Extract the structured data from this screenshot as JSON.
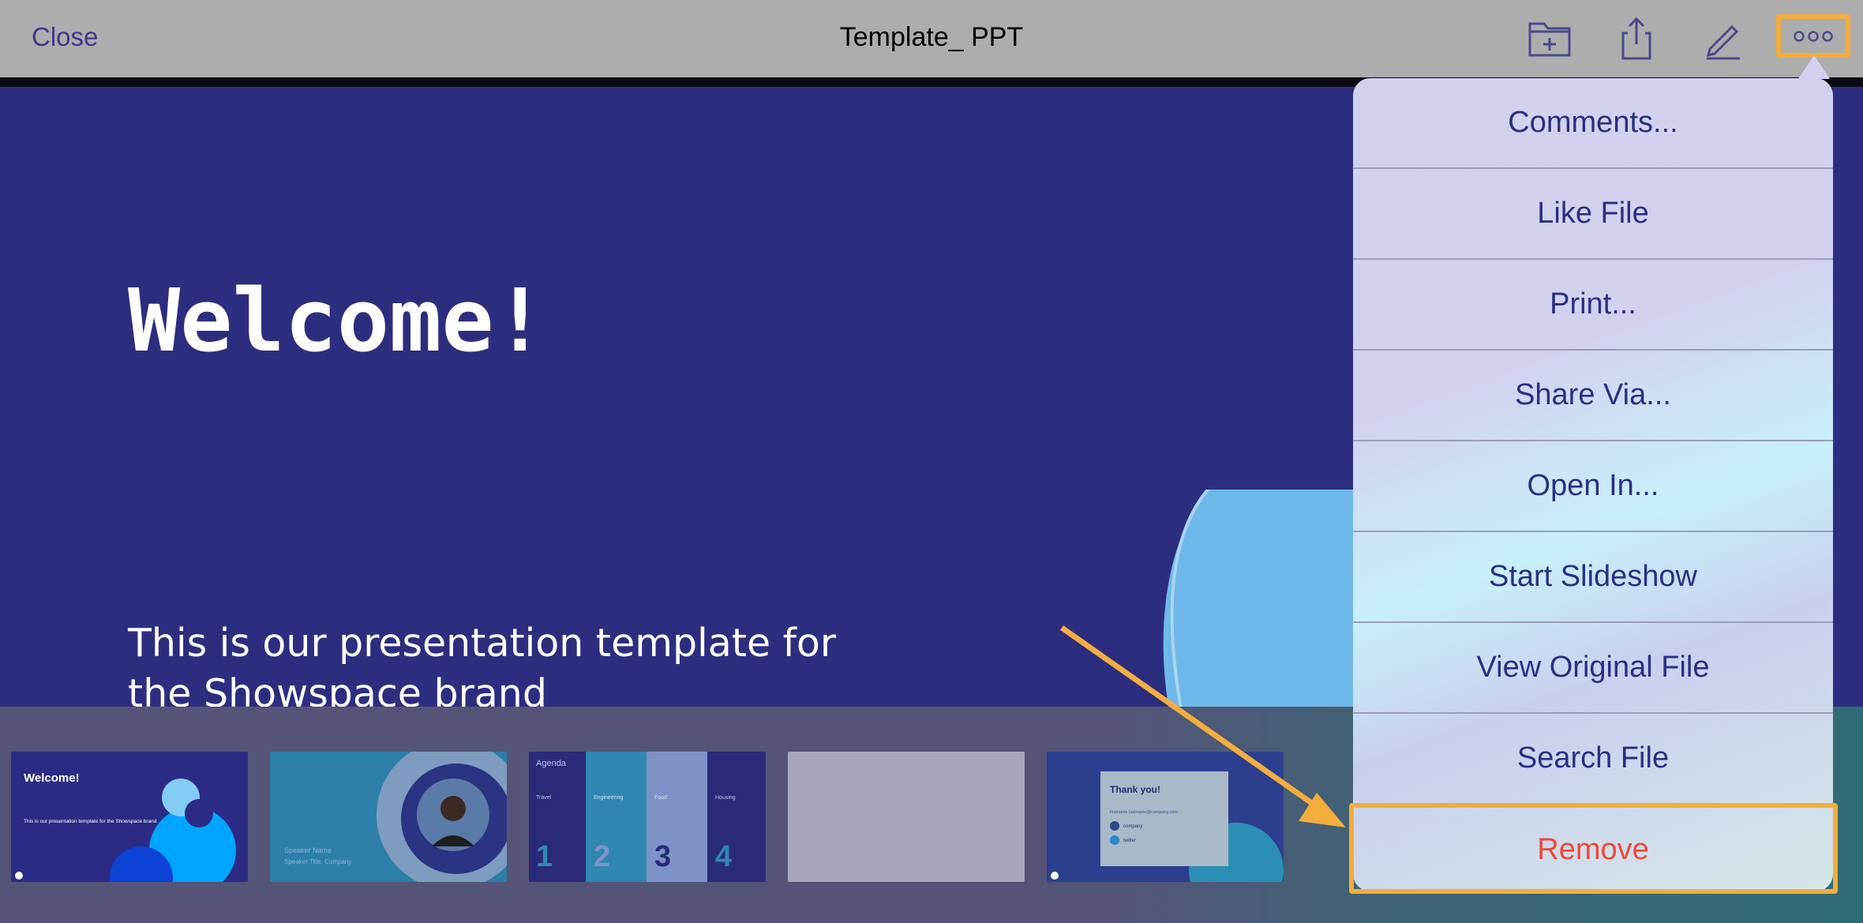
{
  "header": {
    "close_label": "Close",
    "title": "Template_ PPT",
    "icons": [
      "add-to-folder-icon",
      "share-icon",
      "edit-pencil-icon",
      "more-options-icon"
    ]
  },
  "slide": {
    "title": "Welcome!",
    "subtitle": "This is our presentation template for the Showspace brand"
  },
  "thumbnails": {
    "t1": {
      "title": "Welcome!",
      "body": "This is our presentation template for the Showspace brand"
    },
    "t2": {
      "name": "Speaker Name",
      "role": "Speaker Title, Company"
    },
    "t3": {
      "title": "Agenda",
      "cols": [
        "Travel",
        "Engineering",
        "Food",
        "Housing"
      ],
      "nums": [
        "1",
        "2",
        "3",
        "4"
      ]
    },
    "t5": {
      "title": "Thank you!",
      "email": "firstname.lastname@company.com",
      "line1": "company",
      "line2": "twitter"
    }
  },
  "menu": {
    "items": [
      "Comments...",
      "Like File",
      "Print...",
      "Share Via...",
      "Open In...",
      "Start Slideshow",
      "View Original File",
      "Search File",
      "Remove"
    ]
  },
  "colors": {
    "slide_bg": "#2d2d80",
    "menu_text": "#2b2f84",
    "danger": "#f0483a",
    "highlight": "#f2ad3d",
    "topbar": "#adadad"
  }
}
